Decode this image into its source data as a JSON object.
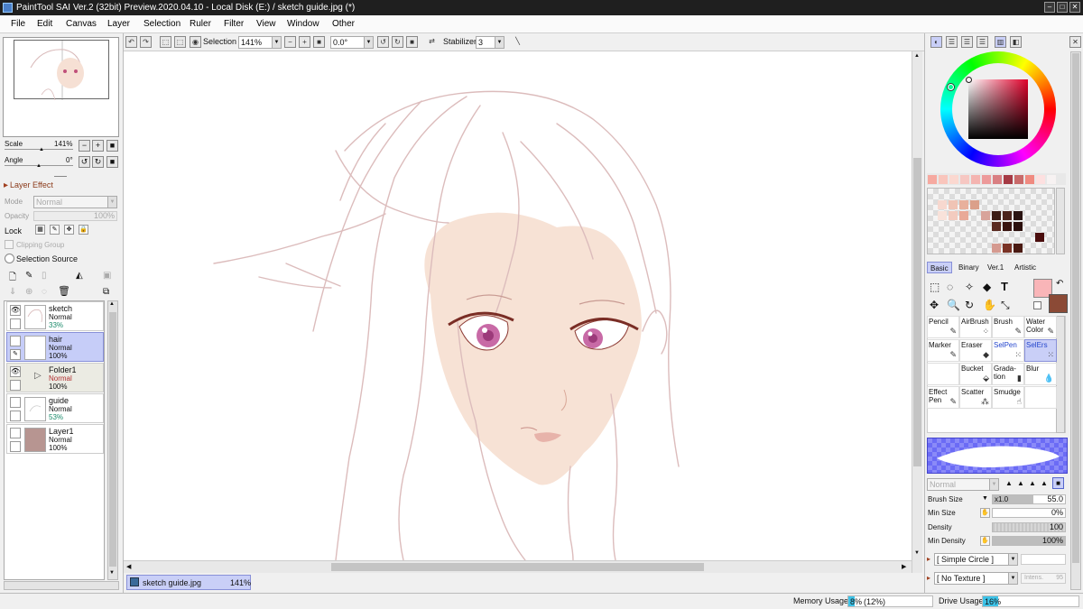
{
  "window": {
    "title": "PaintTool SAI Ver.2 (32bit) Preview.2020.04.10 - Local Disk (E:) / sketch guide.jpg (*)",
    "minimize": "–",
    "maximize": "□",
    "close": "✕"
  },
  "menu": [
    "File",
    "Edit",
    "Canvas",
    "Layer",
    "Selection",
    "Ruler",
    "Filter",
    "View",
    "Window",
    "Other"
  ],
  "toolbar": {
    "selection_label": "Selection",
    "zoom_value": "141%",
    "rotation_value": "0.0°",
    "stabilizer_label": "Stabilizer",
    "stabilizer_value": "3"
  },
  "navigator": {
    "scale_label": "Scale",
    "scale_value": "141%",
    "angle_label": "Angle",
    "angle_value": "0°"
  },
  "layer_effect": {
    "heading": "Layer Effect",
    "mode_label": "Mode",
    "mode_value": "Normal",
    "opacity_label": "Opacity",
    "opacity_value": "100%",
    "lock_label": "Lock",
    "clipping_group": "Clipping Group",
    "selection_source": "Selection Source"
  },
  "layers": [
    {
      "name": "sketch",
      "mode": "Normal",
      "opacity": "33%",
      "visible": true
    },
    {
      "name": "hair",
      "mode": "Normal",
      "opacity": "100%",
      "visible": false
    },
    {
      "name": "Folder1",
      "mode": "Normal",
      "opacity": "100%",
      "visible": true
    },
    {
      "name": "guide",
      "mode": "Normal",
      "opacity": "53%",
      "visible": false
    },
    {
      "name": "Layer1",
      "mode": "Normal",
      "opacity": "100%",
      "visible": false
    }
  ],
  "document_tab": {
    "name": "sketch guide.jpg",
    "zoom": "141%"
  },
  "palette_colors": [
    "#f6a9a0",
    "#f9c5bc",
    "#fbd8d0",
    "#f6c7c2",
    "#f4b4b0",
    "#ed9a9a",
    "#d97f82",
    "#a53a44",
    "#c96a6a",
    "#f08a80",
    "#fde0e0",
    "#f7f2f2"
  ],
  "tool_tabs": [
    "Basic",
    "Binary",
    "Ver.1",
    "Artistic"
  ],
  "tools": [
    {
      "label": "Pencil",
      "icon": "pencil-icon",
      "glyph": "✎"
    },
    {
      "label": "AirBrush",
      "icon": "airbrush-icon",
      "glyph": "⁘"
    },
    {
      "label": "Brush",
      "icon": "brush-icon",
      "glyph": "✎"
    },
    {
      "label": "Water Color",
      "icon": "watercolor-icon",
      "glyph": "✎"
    },
    {
      "label": "Marker",
      "icon": "marker-icon",
      "glyph": "✎"
    },
    {
      "label": "Eraser",
      "icon": "eraser-icon",
      "glyph": "◆"
    },
    {
      "label": "SelPen",
      "icon": "selpen-icon",
      "glyph": "⁙"
    },
    {
      "label": "SelErs",
      "icon": "selers-icon",
      "glyph": "⁙"
    },
    {
      "label": "",
      "icon": "",
      "glyph": ""
    },
    {
      "label": "Bucket",
      "icon": "bucket-icon",
      "glyph": "⬙"
    },
    {
      "label": "Grada-tion",
      "icon": "gradation-icon",
      "glyph": "▮"
    },
    {
      "label": "Blur",
      "icon": "blur-icon",
      "glyph": "💧"
    },
    {
      "label": "Effect Pen",
      "icon": "effect-pen-icon",
      "glyph": "✎"
    },
    {
      "label": "Scatter",
      "icon": "scatter-icon",
      "glyph": "⁂"
    },
    {
      "label": "Smudge",
      "icon": "smudge-icon",
      "glyph": "☝"
    },
    {
      "label": "",
      "icon": "",
      "glyph": ""
    }
  ],
  "brush": {
    "blend_mode": "Normal",
    "size_label": "Brush Size",
    "size_multiplier": "x1.0",
    "size_value": "55.0",
    "min_size_label": "Min Size",
    "min_size_value": "0%",
    "density_label": "Density",
    "density_value": "100",
    "min_density_label": "Min Density",
    "min_density_value": "100%",
    "shape": "[ Simple Circle ]",
    "texture": "[ No Texture ]",
    "texture_intensity": "Intens.",
    "texture_intensity_value": "95"
  },
  "status": {
    "memory_label": "Memory Usage",
    "memory_value": "8%",
    "memory_detail": "(12%)",
    "memory_fraction": 0.08,
    "drive_label": "Drive Usage",
    "drive_value": "16%",
    "drive_fraction": 0.16
  },
  "colors": {
    "selected_tab": "#c9cff7",
    "foreground": "#f9b5b8",
    "background": "#8b4a36"
  }
}
